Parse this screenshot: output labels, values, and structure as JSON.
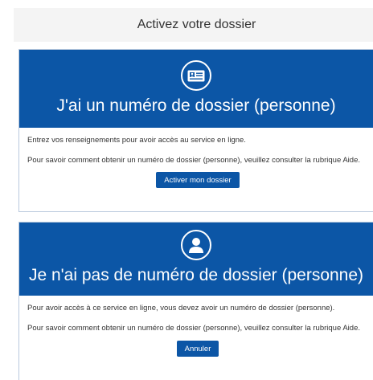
{
  "header": {
    "title": "Activez votre dossier"
  },
  "card_has_number": {
    "icon": "id-card-icon",
    "title": "J'ai un numéro de dossier (personne)",
    "text_1": "Entrez vos renseignements pour avoir accès au service en ligne.",
    "text_2": "Pour savoir comment obtenir un numéro de dossier (personne), veuillez consulter la rubrique Aide.",
    "button_label": "Activer mon dossier"
  },
  "card_no_number": {
    "icon": "user-icon",
    "title": "Je n'ai pas de numéro de dossier (personne)",
    "text_1": "Pour avoir accès à ce service en ligne, vous devez avoir un numéro de dossier (personne).",
    "text_2": "Pour savoir comment obtenir un numéro de dossier (personne), veuillez consulter la rubrique Aide.",
    "button_label": "Annuler"
  },
  "colors": {
    "brand_blue": "#0c56a6",
    "header_bg": "#f4f4f4",
    "card_border": "#b9c9dd"
  }
}
